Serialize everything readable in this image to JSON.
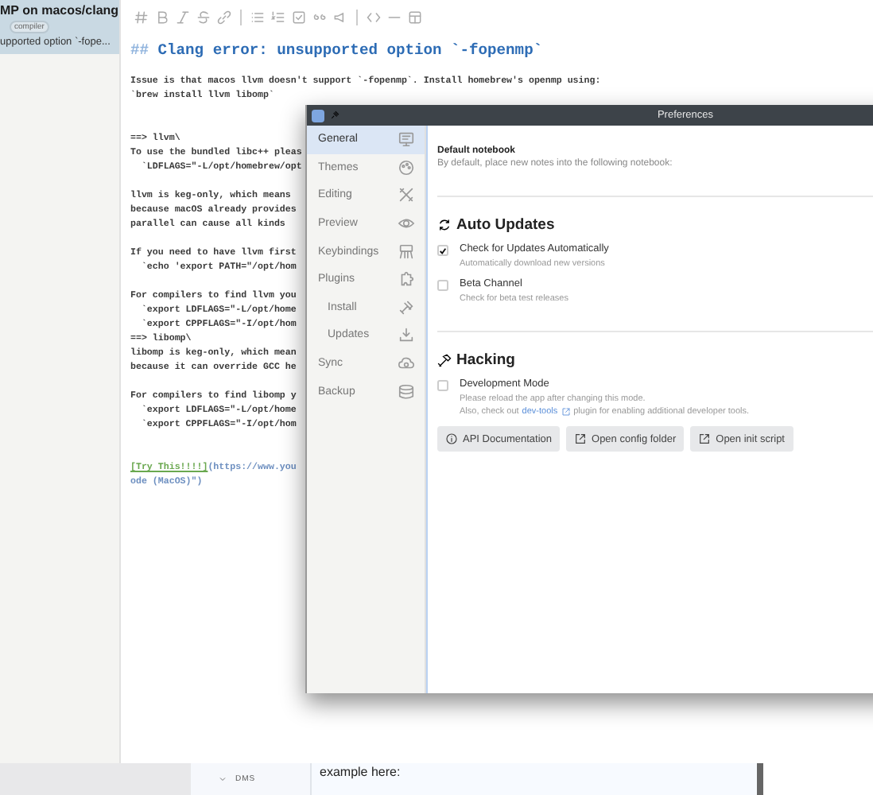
{
  "note_list": {
    "selected_note": {
      "title": "MP on macos/clang",
      "tags": [
        "compiler"
      ],
      "snippet": "upported option `-fope...",
      "selected": true
    }
  },
  "editor": {
    "heading_marker": "##",
    "heading": "Clang error: unsupported option `-fopenmp`",
    "lines": [
      {
        "kind": "code",
        "text": "Issue is that macos llvm doesn't support `-fopenmp`. Install homebrew's openmp using:"
      },
      {
        "kind": "code",
        "text": "`brew install llvm libomp`"
      },
      {
        "kind": "blank"
      },
      {
        "kind": "blank"
      },
      {
        "kind": "code",
        "text": "==> llvm\\"
      },
      {
        "kind": "code",
        "text": "To use the bundled libc++ pleas"
      },
      {
        "kind": "code",
        "text": "  `LDFLAGS=\"-L/opt/homebrew/opt"
      },
      {
        "kind": "blank"
      },
      {
        "kind": "code",
        "text": "llvm is keg-only, which means"
      },
      {
        "kind": "code",
        "text": "because macOS already provides"
      },
      {
        "kind": "code",
        "text": "parallel can cause all kinds"
      },
      {
        "kind": "blank"
      },
      {
        "kind": "code",
        "text": "If you need to have llvm first"
      },
      {
        "kind": "code",
        "text": "  `echo 'export PATH=\"/opt/hom"
      },
      {
        "kind": "blank"
      },
      {
        "kind": "code",
        "text": "For compilers to find llvm you"
      },
      {
        "kind": "code",
        "text": "  `export LDFLAGS=\"-L/opt/home"
      },
      {
        "kind": "code",
        "text": "  `export CPPFLAGS=\"-I/opt/hom"
      },
      {
        "kind": "code",
        "text": "==> libomp\\"
      },
      {
        "kind": "code",
        "text": "libomp is keg-only, which mean"
      },
      {
        "kind": "code",
        "text": "because it can override GCC he"
      },
      {
        "kind": "blank"
      },
      {
        "kind": "code",
        "text": "For compilers to find libomp y"
      },
      {
        "kind": "code",
        "text": "  `export LDFLAGS=\"-L/opt/home"
      },
      {
        "kind": "code",
        "text": "  `export CPPFLAGS=\"-I/opt/hom"
      },
      {
        "kind": "blank"
      },
      {
        "kind": "blank"
      },
      {
        "kind": "link",
        "label": "[Try This!!!!]",
        "url": "(https://www.you"
      },
      {
        "kind": "url",
        "text": "ode (MacOS)\")"
      }
    ]
  },
  "preferences": {
    "title": "Preferences",
    "nav": [
      {
        "label": "General",
        "selected": true
      },
      {
        "label": "Themes",
        "selected": false
      },
      {
        "label": "Editing",
        "selected": false
      },
      {
        "label": "Preview",
        "selected": false
      },
      {
        "label": "Keybindings",
        "selected": false
      },
      {
        "label": "Plugins",
        "selected": false,
        "children": [
          {
            "label": "Install",
            "selected": false
          },
          {
            "label": "Updates",
            "selected": false
          }
        ]
      },
      {
        "label": "Sync",
        "selected": false
      },
      {
        "label": "Backup",
        "selected": false
      }
    ],
    "default_notebook": {
      "label": "Default notebook",
      "description": "By default, place new notes into the following notebook:"
    },
    "sections": [
      {
        "kind": "updates",
        "title": "Auto Updates",
        "options": [
          {
            "label": "Check for Updates Automatically",
            "checked": true,
            "descriptions": [
              "Automatically download new versions"
            ]
          },
          {
            "label": "Beta Channel",
            "checked": false,
            "descriptions": [
              "Check for beta test releases"
            ]
          }
        ]
      },
      {
        "kind": "hacking",
        "title": "Hacking",
        "options": [
          {
            "label": "Development Mode",
            "checked": false,
            "descriptions": [
              "Please reload the app after changing this mode."
            ]
          }
        ],
        "note": {
          "before": "Also, check out",
          "link": "dev-tools",
          "after": "plugin for enabling additional developer tools."
        },
        "buttons": [
          {
            "kind": "info",
            "label": "API Documentation"
          },
          {
            "kind": "external",
            "label": "Open config folder"
          },
          {
            "kind": "external",
            "label": "Open init script"
          }
        ]
      }
    ]
  },
  "bottom_panel": {
    "sidebar_item": {
      "label": "DMS",
      "expanded": true
    },
    "message_field": {
      "value": "example here:"
    }
  }
}
